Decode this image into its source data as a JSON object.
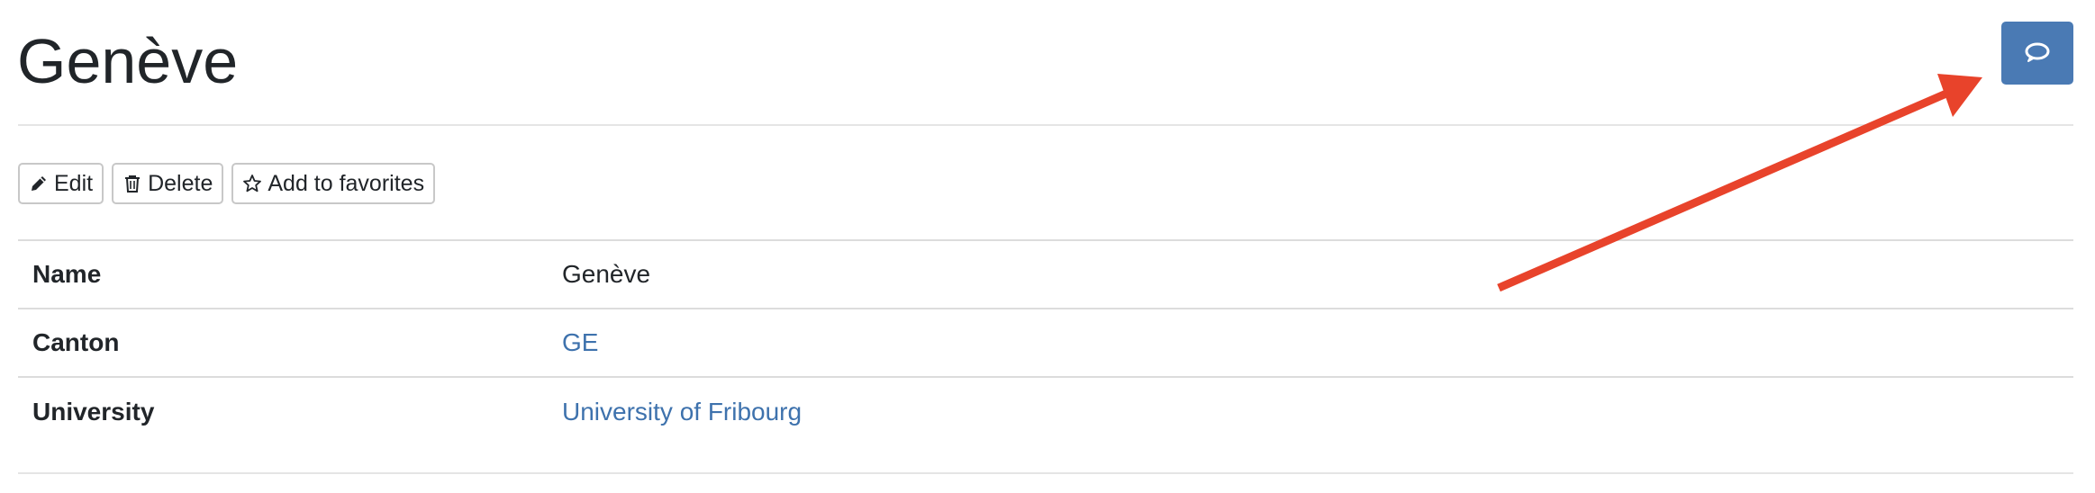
{
  "page": {
    "title": "Genève"
  },
  "header": {
    "comment_button_icon": "comment-icon",
    "button_color": "#4a7ab4"
  },
  "toolbar": {
    "edit_label": "Edit",
    "edit_icon": "pencil-icon",
    "delete_label": "Delete",
    "delete_icon": "trash-icon",
    "favorites_label": "Add to favorites",
    "favorites_icon": "star-icon"
  },
  "details": {
    "rows": [
      {
        "label": "Name",
        "value": "Genève",
        "link": false
      },
      {
        "label": "Canton",
        "value": "GE",
        "link": true
      },
      {
        "label": "University",
        "value": "University of Fribourg",
        "link": true
      }
    ]
  },
  "annotation": {
    "arrow_color": "#e8432b"
  },
  "colors": {
    "link": "#3e72ad",
    "text": "#212529"
  }
}
